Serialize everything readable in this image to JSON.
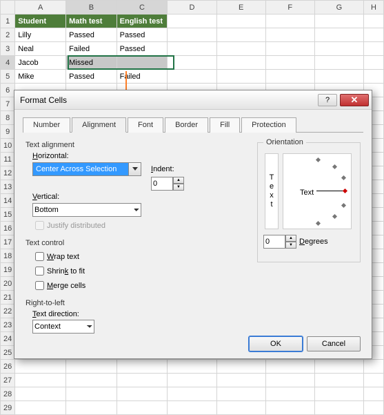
{
  "columns": [
    "",
    "A",
    "B",
    "C",
    "D",
    "E",
    "F",
    "G",
    "H"
  ],
  "rows_visible": 29,
  "headers": {
    "a": "Student",
    "b": "Math test",
    "c": "English test"
  },
  "data": [
    {
      "r": 2,
      "a": "Lilly",
      "b": "Passed",
      "c": "Passed"
    },
    {
      "r": 3,
      "a": "Neal",
      "b": "Failed",
      "c": "Passed"
    },
    {
      "r": 4,
      "a": "Jacob",
      "b": "Missed",
      "c": ""
    },
    {
      "r": 5,
      "a": "Mike",
      "b": "Passed",
      "c": "Failed"
    }
  ],
  "selected_cols": [
    "B",
    "C"
  ],
  "selected_row": 4,
  "dialog": {
    "title": "Format Cells",
    "help_icon": "?",
    "close_icon": "✕",
    "tabs": [
      "Number",
      "Alignment",
      "Font",
      "Border",
      "Fill",
      "Protection"
    ],
    "active_tab": "Alignment",
    "text_alignment": {
      "label": "Text alignment",
      "horizontal_label": "Horizontal:",
      "horizontal_value": "Center Across Selection",
      "indent_label": "Indent:",
      "indent_value": "0",
      "vertical_label": "Vertical:",
      "vertical_value": "Bottom",
      "justify_label": "Justify distributed"
    },
    "text_control": {
      "label": "Text control",
      "wrap": "Wrap text",
      "shrink": "Shrink to fit",
      "merge": "Merge cells"
    },
    "rtl": {
      "label": "Right-to-left",
      "dir_label": "Text direction:",
      "dir_value": "Context"
    },
    "orientation": {
      "label": "Orientation",
      "vtext": "Text",
      "htext": "Text",
      "degrees_value": "0",
      "degrees_label": "Degrees"
    },
    "ok": "OK",
    "cancel": "Cancel"
  }
}
